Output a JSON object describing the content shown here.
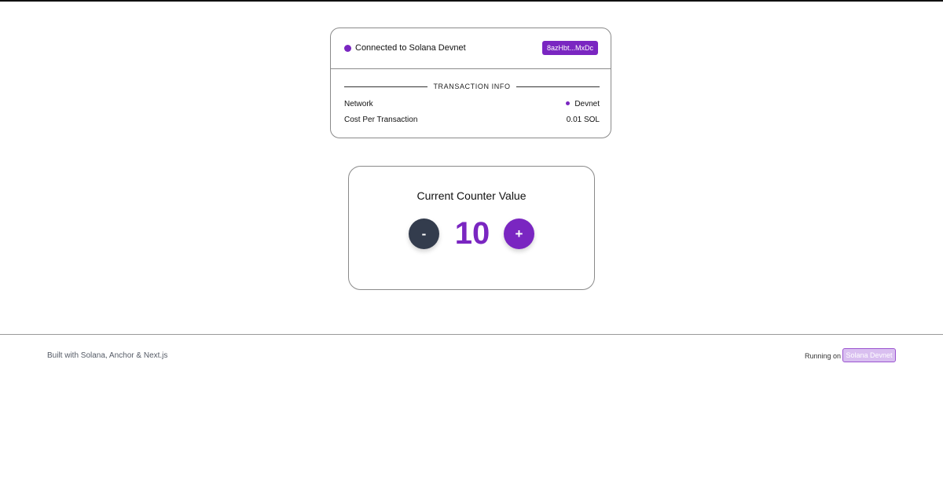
{
  "connection": {
    "status_text": "Connected to Solana Devnet",
    "wallet_short": "8azHbt...MxDc"
  },
  "transaction_info": {
    "title": "TRANSACTION INFO",
    "rows": [
      {
        "label": "Network",
        "value": "Devnet"
      },
      {
        "label": "Cost Per Transaction",
        "value": "0.01 SOL"
      }
    ]
  },
  "counter": {
    "title": "Current Counter Value",
    "value": "10",
    "decrement_label": "-",
    "increment_label": "+"
  },
  "footer": {
    "built_with": "Built with Solana, Anchor & Next.js",
    "running_on_label": "Running on",
    "network_badge": "Solana Devnet"
  },
  "colors": {
    "accent": "#7a26c1",
    "dark_button": "#333c4d",
    "badge_light": "#d9bff0"
  }
}
